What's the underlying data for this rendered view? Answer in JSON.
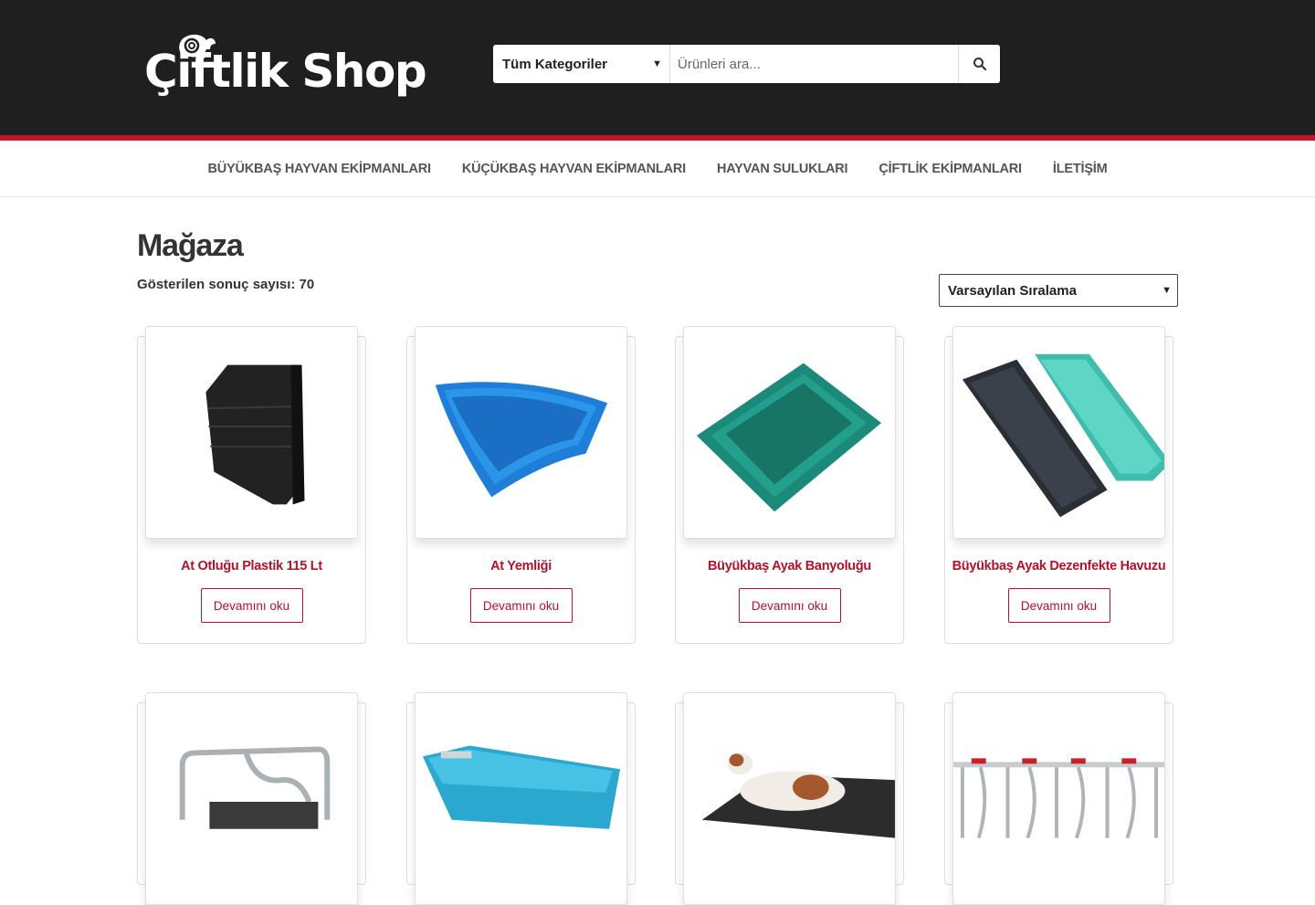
{
  "brand": {
    "logo_text": "Çiftlik Shop"
  },
  "search": {
    "category_selected": "Tüm Kategoriler",
    "placeholder": "Ürünleri ara...",
    "button_icon": "search-icon"
  },
  "nav": {
    "items": [
      {
        "label": "BÜYÜKBAŞ HAYVAN EKİPMANLARI"
      },
      {
        "label": "KÜÇÜKBAŞ HAYVAN EKİPMANLARI"
      },
      {
        "label": "HAYVAN SULUKLARI"
      },
      {
        "label": "ÇİFTLİK EKİPMANLARI"
      },
      {
        "label": "İLETİŞİM"
      }
    ]
  },
  "shop": {
    "title": "Mağaza",
    "result_count": "Gösterilen sonuç sayısı: 70",
    "sort_selected": "Varsayılan Sıralama"
  },
  "products": [
    {
      "title": "At Otluğu Plastik 115 Lt",
      "button": "Devamını oku"
    },
    {
      "title": "At Yemliği",
      "button": "Devamını oku"
    },
    {
      "title": "Büyükbaş Ayak Banyoluğu",
      "button": "Devamını oku"
    },
    {
      "title": "Büyükbaş Ayak Dezenfekte Havuzu",
      "button": "Devamını oku"
    }
  ],
  "colors": {
    "header_bg": "#1f1f1f",
    "accent_red": "#c0182a",
    "product_title": "#b3122a"
  }
}
